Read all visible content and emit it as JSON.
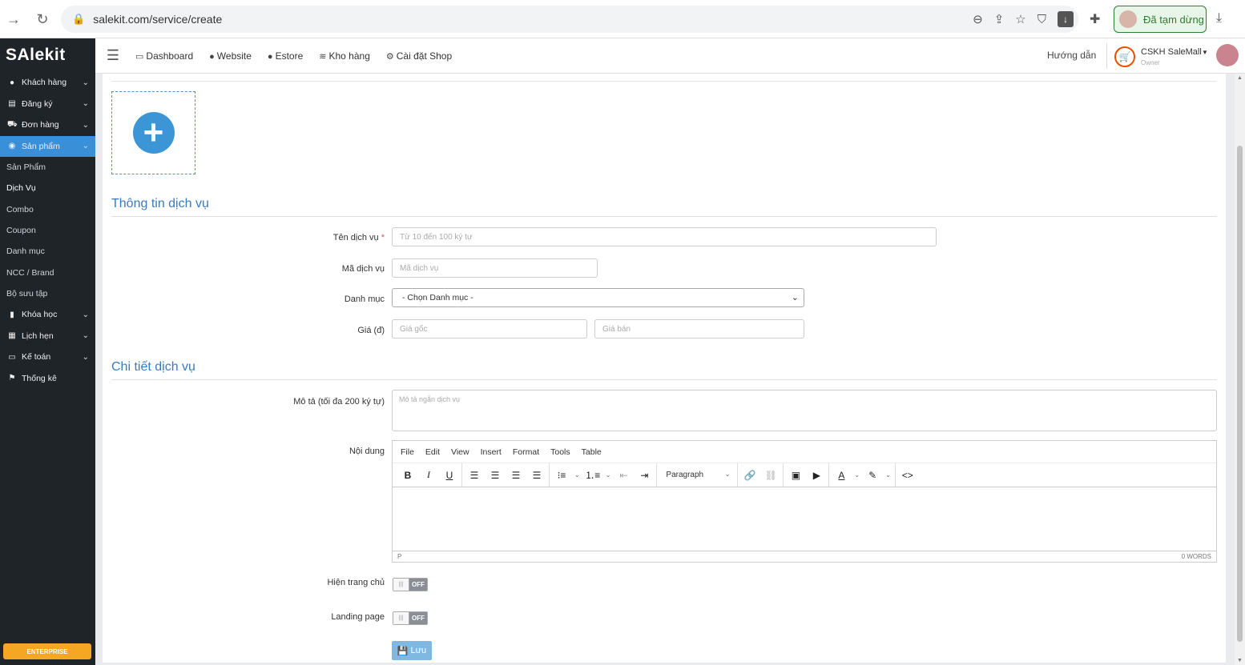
{
  "browser": {
    "url": "salekit.com/service/create",
    "paused_label": "Đã tạm dừng"
  },
  "sidebar": {
    "logo": "SAlekit",
    "items": [
      {
        "label": "Khách hàng",
        "icon": "user-icon"
      },
      {
        "label": "Đăng ký",
        "icon": "list-icon"
      },
      {
        "label": "Đơn hàng",
        "icon": "cart-icon"
      },
      {
        "label": "Sản phẩm",
        "icon": "product-icon"
      },
      {
        "label": "Khóa học",
        "icon": "book-icon"
      },
      {
        "label": "Lịch hẹn",
        "icon": "calendar-icon"
      },
      {
        "label": "Kế toán",
        "icon": "credit-card-icon"
      },
      {
        "label": "Thống kê",
        "icon": "flag-icon"
      }
    ],
    "sub_items": [
      "Sản Phẩm",
      "Dịch Vụ",
      "Combo",
      "Coupon",
      "Danh mục",
      "NCC / Brand",
      "Bộ sưu tập"
    ],
    "enterprise_label": "ENTERPRISE"
  },
  "topbar": {
    "nav": [
      "Dashboard",
      "Website",
      "Estore",
      "Kho hàng",
      "Cài đặt Shop"
    ],
    "guide": "Hướng dẫn",
    "shop_name": "CSKH SaleMall",
    "shop_role": "Owner"
  },
  "form": {
    "section1_title": "Thông tin dịch vụ",
    "name_label": "Tên dịch vụ",
    "name_required": "*",
    "name_placeholder": "Từ 10 đến 100 ký tự",
    "code_label": "Mã dịch vụ",
    "code_placeholder": "Mã dịch vụ",
    "category_label": "Danh mục",
    "category_value": "- Chọn Danh mục -",
    "price_label": "Giá (đ)",
    "price_original_placeholder": "Giá gốc",
    "price_sale_placeholder": "Giá bán",
    "section2_title": "Chi tiết dịch vụ",
    "desc_label": "Mô tả (tối đa 200 ký tự)",
    "desc_placeholder": "Mô tả ngắn dịch vụ",
    "content_label": "Nội dung",
    "homepage_label": "Hiện trang chủ",
    "landing_label": "Landing page",
    "toggle_off": "OFF",
    "save_label": "Lưu"
  },
  "editor": {
    "menus": [
      "File",
      "Edit",
      "View",
      "Insert",
      "Format",
      "Tools",
      "Table"
    ],
    "paragraph": "Paragraph",
    "path": "P",
    "word_count": "0 WORDS"
  }
}
